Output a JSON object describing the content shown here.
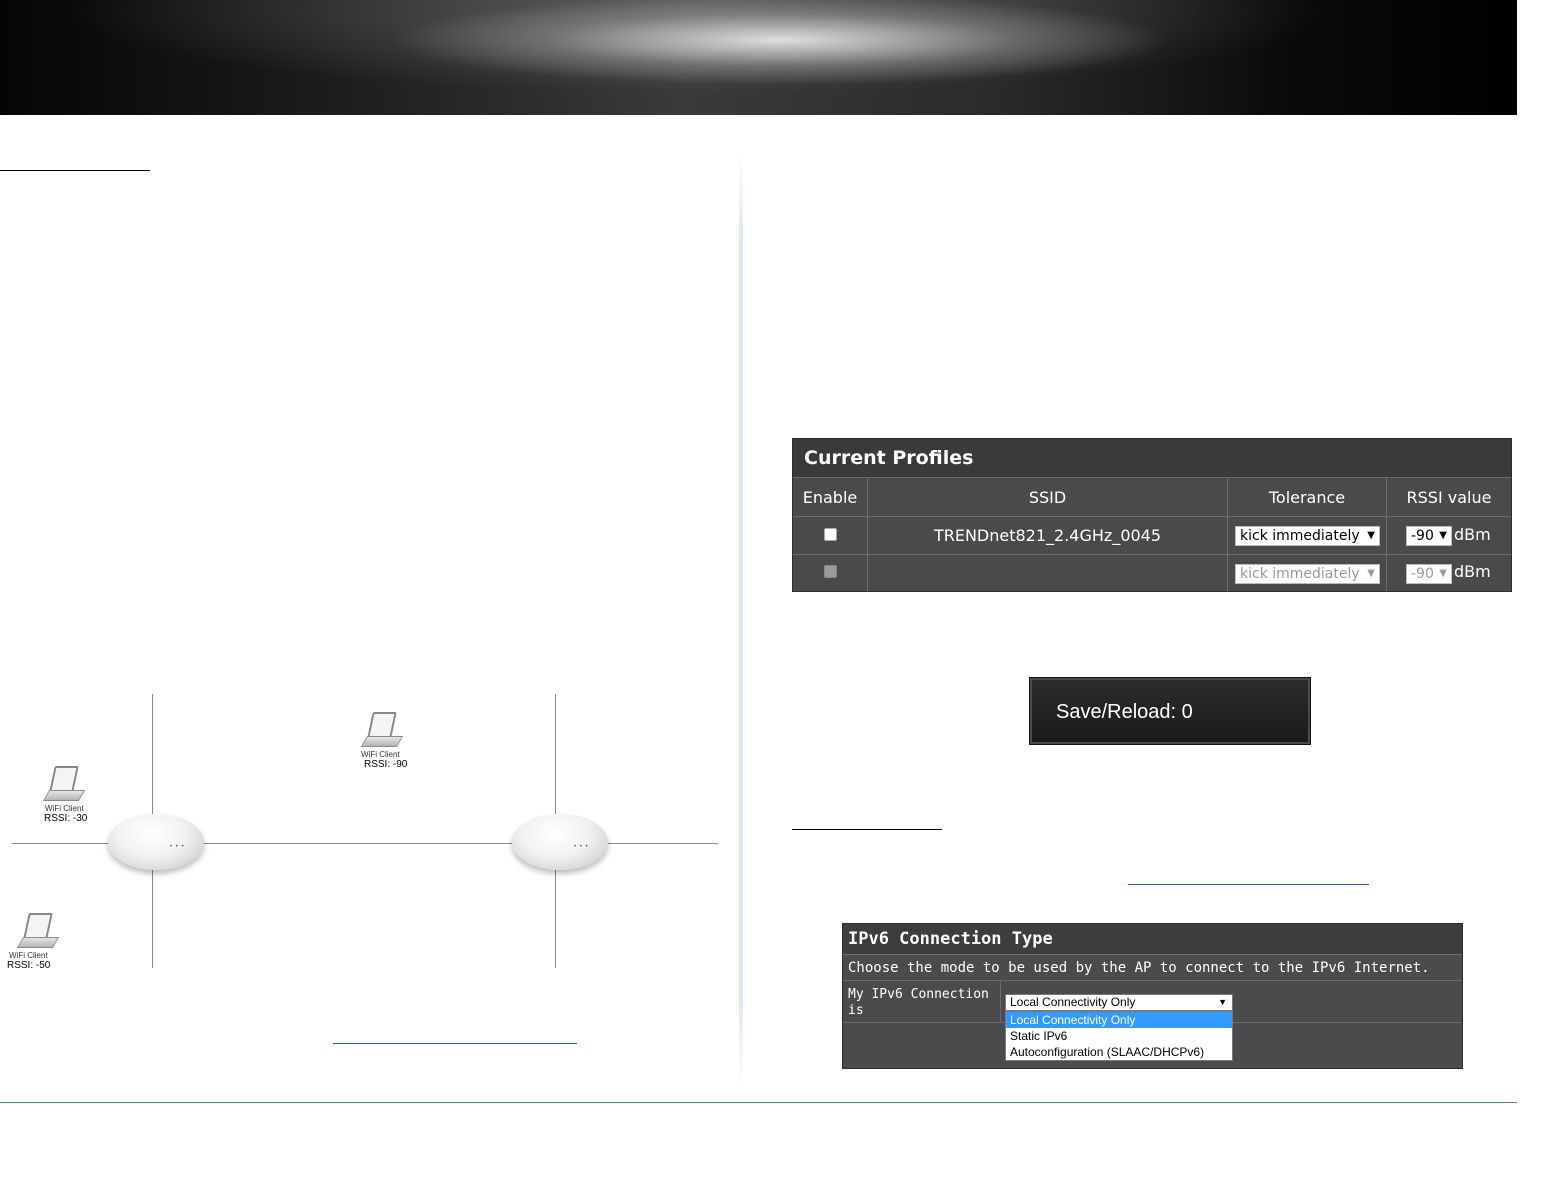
{
  "profiles": {
    "title": "Current Profiles",
    "headers": {
      "enable": "Enable",
      "ssid": "SSID",
      "tolerance": "Tolerance",
      "rssi": "RSSI value"
    },
    "rows": [
      {
        "enabled": false,
        "disabled": false,
        "ssid": "TRENDnet821_2.4GHz_0045",
        "tolerance": "kick immediately",
        "rssi": "-90",
        "unit": "dBm"
      },
      {
        "enabled": false,
        "disabled": true,
        "ssid": "",
        "tolerance": "kick immediately",
        "rssi": "-90",
        "unit": "dBm"
      }
    ]
  },
  "save_reload": "Save/Reload: 0",
  "diagram": {
    "clients": [
      {
        "label": "WiFi Client",
        "rssi": "RSSI: -30"
      },
      {
        "label": "WiFi Client",
        "rssi": "RSSI: -90"
      },
      {
        "label": "WiFi Client",
        "rssi": "RSSI: -50"
      }
    ]
  },
  "ipv6": {
    "title": "IPv6 Connection Type",
    "description": "Choose the mode to be used by the AP to connect to the IPv6 Internet.",
    "label": "My IPv6 Connection is",
    "selected": "Local Connectivity Only",
    "options": [
      "Local Connectivity Only",
      "Static IPv6",
      "Autoconfiguration (SLAAC/DHCPv6)"
    ]
  }
}
